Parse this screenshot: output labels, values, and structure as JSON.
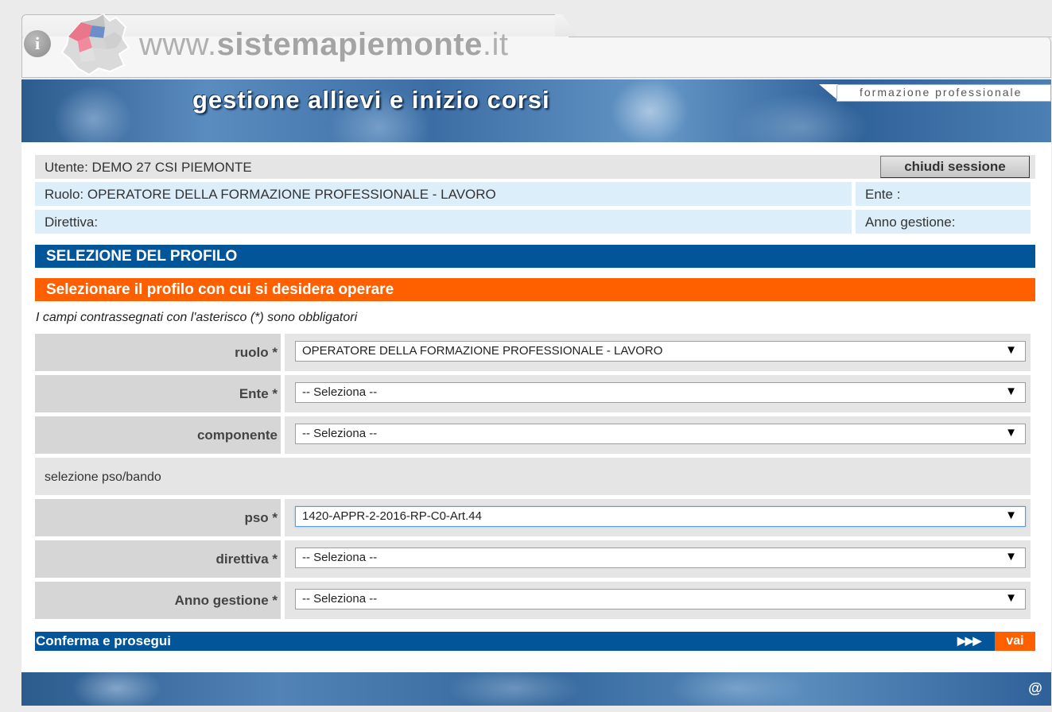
{
  "header": {
    "site_prefix": "www.",
    "site_name": "sistemapiemonte",
    "site_suffix": ".it",
    "info_icon": "i"
  },
  "banner": {
    "title": "gestione allievi e inizio corsi",
    "tag": "formazione professionale"
  },
  "user_info": {
    "utente_label": "Utente: ",
    "utente_value": "DEMO 27 CSI PIEMONTE",
    "logout_label": "chiudi sessione",
    "ruolo_text": "Ruolo: OPERATORE DELLA FORMAZIONE PROFESSIONALE - LAVORO",
    "ente_label": "Ente :",
    "direttiva_label": "Direttiva:",
    "anno_label": "Anno gestione:"
  },
  "section_title": "SELEZIONE DEL PROFILO",
  "subtitle": "Selezionare il profilo con cui si desidera operare",
  "required_note": "I campi contrassegnati con l'asterisco (*) sono obbligatori",
  "form": {
    "ruolo": {
      "label": "ruolo *",
      "value": "OPERATORE DELLA FORMAZIONE PROFESSIONALE - LAVORO"
    },
    "ente": {
      "label": "Ente *",
      "value": "-- Seleziona --"
    },
    "componente": {
      "label": "componente",
      "value": "-- Seleziona --"
    },
    "pso_section": "selezione pso/bando",
    "pso": {
      "label": "pso *",
      "value": "1420-APPR-2-2016-RP-C0-Art.44"
    },
    "direttiva": {
      "label": "direttiva *",
      "value": "-- Seleziona --"
    },
    "anno": {
      "label": "Anno gestione *",
      "value": "-- Seleziona --"
    },
    "dropdown_arrow": "▼"
  },
  "confirm": {
    "label": "Conferma e prosegui",
    "arrows": "▶▶▶",
    "button": "vai"
  },
  "footer": {
    "at_icon": "@"
  },
  "colors": {
    "primary_blue": "#03559a",
    "accent_orange": "#fe6000",
    "light_blue_row": "#ddeefb"
  }
}
